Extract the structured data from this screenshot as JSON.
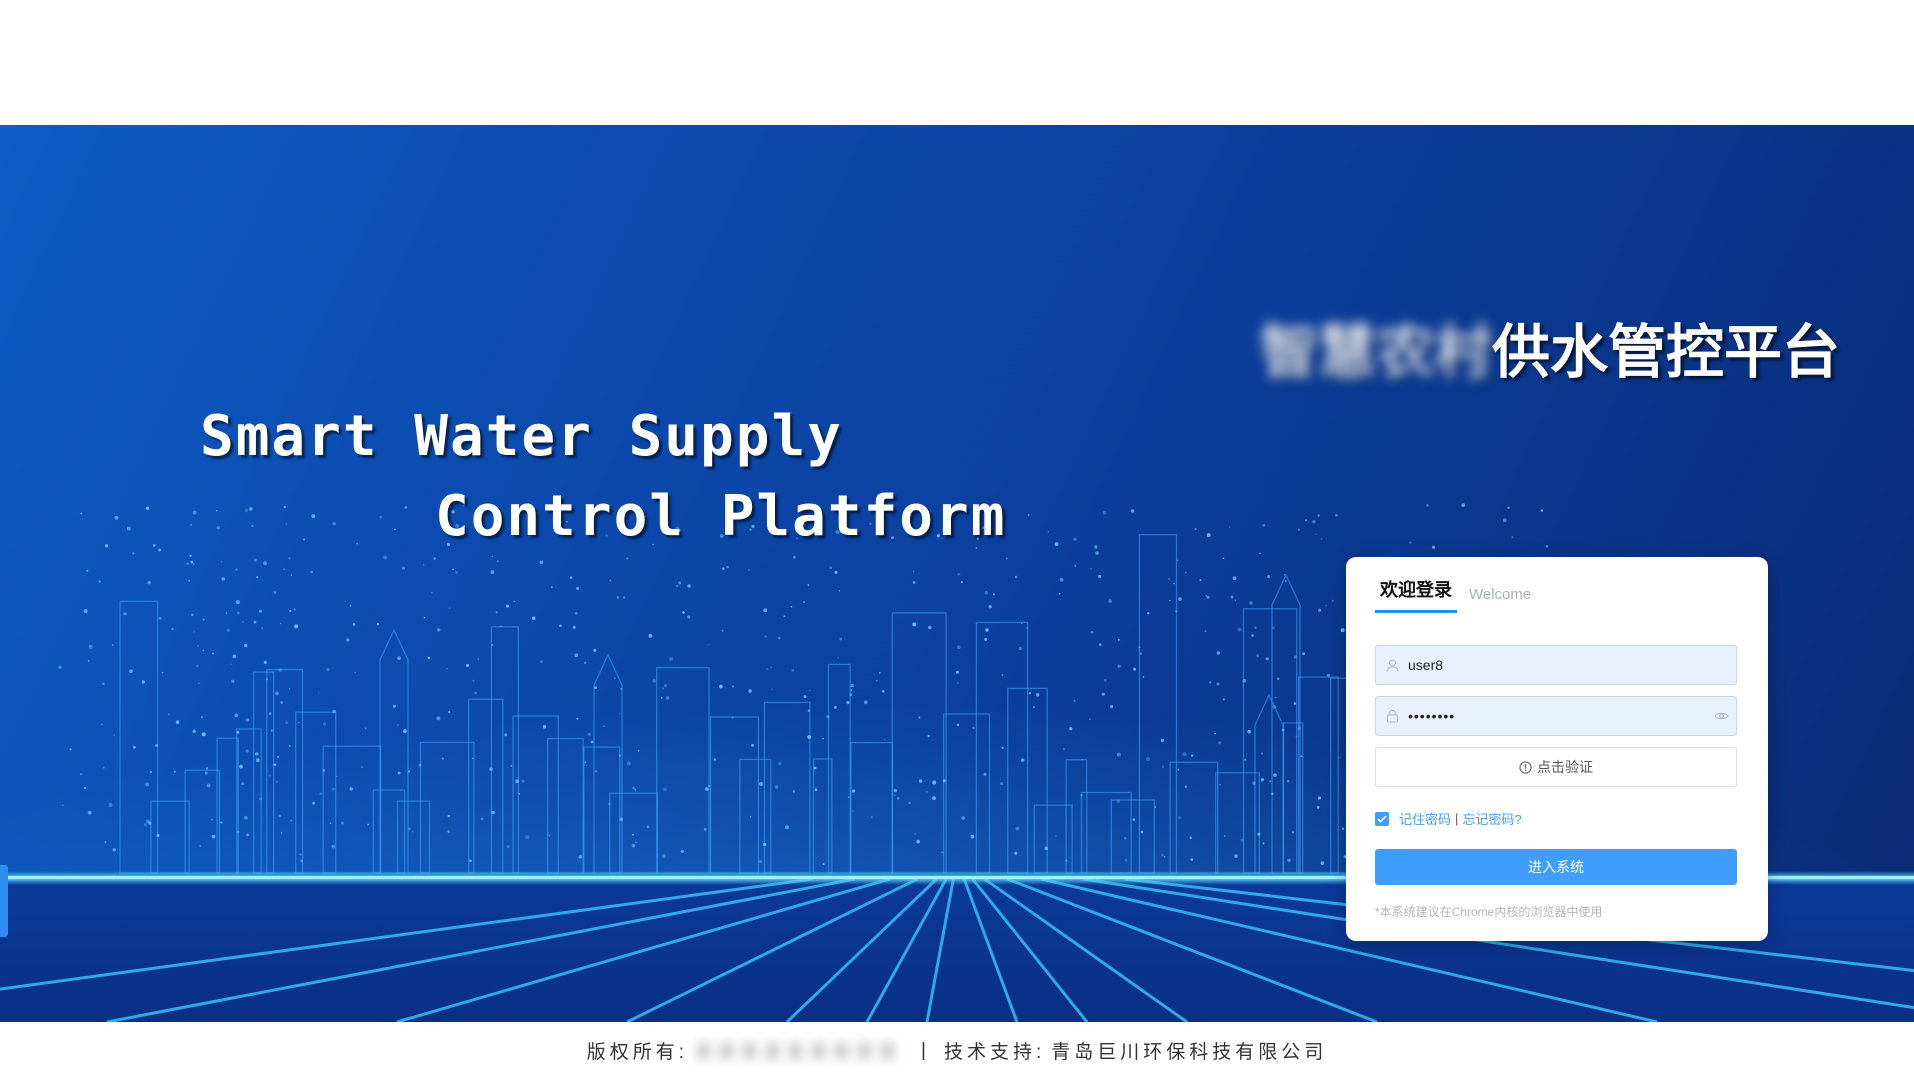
{
  "title": {
    "en_line1": "Smart Water Supply",
    "en_line2": "Control Platform",
    "cn_prefix_blurred": "智慧农村",
    "cn_main": "供水管控平台"
  },
  "login": {
    "tab_active": "欢迎登录",
    "tab_welcome": "Welcome",
    "username_value": "user8",
    "password_value": "••••••••",
    "verify_label": "点击验证",
    "remember_checked": true,
    "remember_label": "记住密码",
    "separator": "|",
    "forgot_label": "忘记密码?",
    "submit_label": "进入系统",
    "hint": "*本系统建议在Chrome内核的浏览器中使用"
  },
  "footer": {
    "copyright_label": "版权所有:",
    "copyright_value_blurred": "某某某某某某某某某",
    "divider": "|",
    "support_label": "技术支持:",
    "support_value": "青岛巨川环保科技有限公司"
  },
  "colors": {
    "primary": "#409eff",
    "tab_underline": "#1f8ff0",
    "hero_dark": "#0a2a74",
    "hero_light": "#0e5cc4",
    "glow": "#33c4ff"
  },
  "icons": [
    "user-icon",
    "lock-icon",
    "eye-icon",
    "info-circle-icon",
    "check-icon"
  ]
}
